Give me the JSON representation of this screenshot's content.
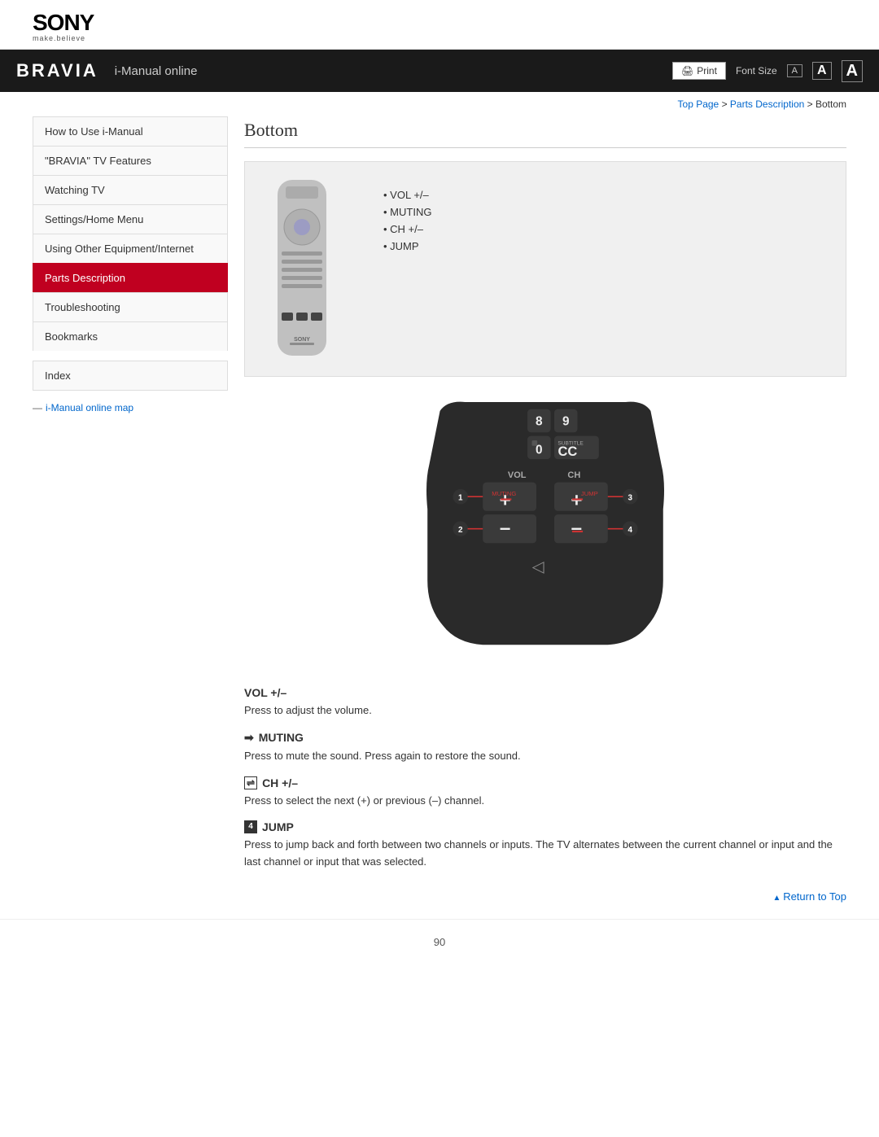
{
  "header": {
    "brand": "SONY",
    "tagline": "make.believe",
    "bravia": "BRAVIA",
    "nav_title": "i-Manual online",
    "print_label": "Print",
    "font_size_label": "Font Size",
    "font_small": "A",
    "font_medium": "A",
    "font_large": "A"
  },
  "breadcrumb": {
    "top_page": "Top Page",
    "parts_description": "Parts Description",
    "current": "Bottom"
  },
  "sidebar": {
    "items": [
      {
        "id": "how-to-use",
        "label": "How to Use i-Manual",
        "active": false
      },
      {
        "id": "bravia-features",
        "label": "\"BRAVIA\" TV Features",
        "active": false
      },
      {
        "id": "watching-tv",
        "label": "Watching TV",
        "active": false
      },
      {
        "id": "settings-home",
        "label": "Settings/Home Menu",
        "active": false
      },
      {
        "id": "using-other",
        "label": "Using Other Equipment/Internet",
        "active": false
      },
      {
        "id": "parts-description",
        "label": "Parts Description",
        "active": true
      },
      {
        "id": "troubleshooting",
        "label": "Troubleshooting",
        "active": false
      },
      {
        "id": "bookmarks",
        "label": "Bookmarks",
        "active": false
      }
    ],
    "index_label": "Index",
    "map_label": "i-Manual online map"
  },
  "content": {
    "page_title": "Bottom",
    "bullet_items": [
      "VOL +/–",
      "MUTING",
      "CH +/–",
      "JUMP"
    ],
    "descriptions": [
      {
        "id": "vol",
        "icon": "none",
        "title": "VOL +/–",
        "body": "Press to adjust the volume."
      },
      {
        "id": "muting",
        "icon": "arrow",
        "title": "MUTING",
        "body": "Press to mute the sound. Press again to restore the sound."
      },
      {
        "id": "ch",
        "icon": "ch",
        "title": "CH +/–",
        "body": "Press to select the next (+) or previous (–) channel."
      },
      {
        "id": "jump",
        "icon": "4",
        "title": "JUMP",
        "body": "Press to jump back and forth between two channels or inputs. The TV alternates between the current channel or input and the last channel or input that was selected."
      }
    ],
    "page_number": "90",
    "return_to_top": "Return to Top"
  }
}
